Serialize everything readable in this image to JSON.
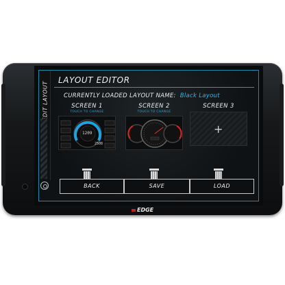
{
  "screen": {
    "title": "LAYOUT EDITOR",
    "rail_label": "EDIT LAYOUT",
    "current_layout_label": "CURRENTLY LOADED LAYOUT NAME:",
    "current_layout_name": "Black Layout",
    "slots": [
      {
        "label": "SCREEN 1",
        "sub": "TOUCH TO CHANGE",
        "preview": "gauge-cluster-1",
        "center_value": "1209",
        "secondary_value": "2508"
      },
      {
        "label": "SCREEN 2",
        "sub": "TOUCH TO CHANGE",
        "preview": "gauge-cluster-2"
      },
      {
        "label": "SCREEN 3",
        "sub": "",
        "preview": "empty"
      }
    ],
    "buttons": {
      "back": "BACK",
      "save": "SAVE",
      "load": "LOAD"
    }
  },
  "device": {
    "logo_text": "EDGE"
  },
  "colors": {
    "accent": "#2ab6ec",
    "frame": "#1d88b0"
  }
}
